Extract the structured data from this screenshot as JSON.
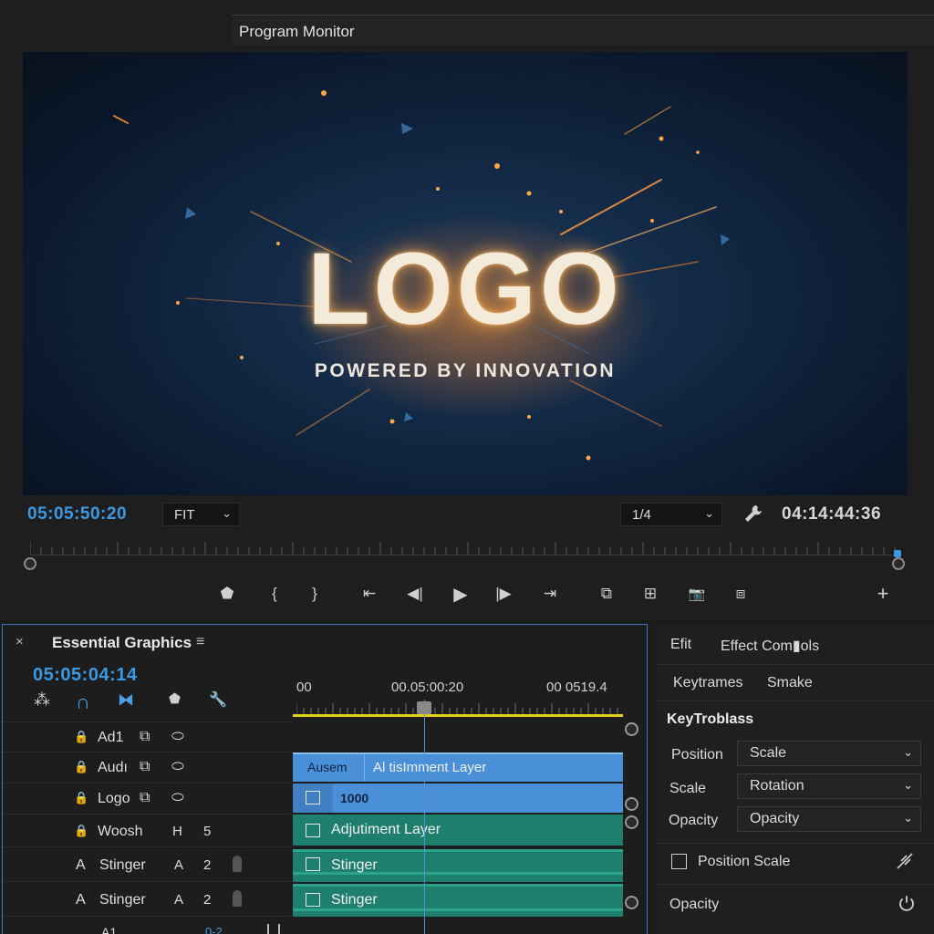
{
  "colors": {
    "accent_blue": "#3c9ae4",
    "clip_blue": "#4a90d9",
    "clip_teal": "#1f7f6e",
    "work_area_yellow": "#e6d21a",
    "panel_border": "#3a78c4"
  },
  "monitor": {
    "tab_title": "Program Monitor",
    "preview": {
      "logo": "LOGO",
      "tagline": "POWERED BY INNOVATION"
    },
    "current_timecode": "05:05:50:20",
    "zoom_value": "FIT",
    "resolution_value": "1/4",
    "duration_timecode": "04:14:44:36",
    "settings_icon": "wrench-icon",
    "transport": [
      {
        "name": "add-marker-button",
        "icon": "marker-icon",
        "glyph": "⬟"
      },
      {
        "name": "mark-in-button",
        "icon": "mark-in-icon",
        "glyph": "{"
      },
      {
        "name": "mark-out-button",
        "icon": "mark-out-icon",
        "glyph": "}"
      },
      {
        "name": "go-to-in-button",
        "icon": "go-to-in-icon",
        "glyph": "⇤"
      },
      {
        "name": "step-back-button",
        "icon": "step-back-icon",
        "glyph": "◀|"
      },
      {
        "name": "play-button",
        "icon": "play-icon",
        "glyph": "▶"
      },
      {
        "name": "step-forward-button",
        "icon": "step-forward-icon",
        "glyph": "|▶"
      },
      {
        "name": "go-to-out-button",
        "icon": "go-to-out-icon",
        "glyph": "⇥"
      },
      {
        "name": "lift-button",
        "icon": "lift-icon",
        "glyph": "⧉"
      },
      {
        "name": "extract-button",
        "icon": "extract-icon",
        "glyph": "⊞"
      },
      {
        "name": "export-frame-button",
        "icon": "camera-icon",
        "glyph": "📷"
      },
      {
        "name": "comparison-view-button",
        "icon": "comparison-icon",
        "glyph": "⧈"
      },
      {
        "name": "button-editor-button",
        "icon": "plus-icon",
        "glyph": "+"
      }
    ]
  },
  "essential_graphics": {
    "close_glyph": "×",
    "title": "Essential Graphics",
    "menu_glyph": "≡",
    "timecode": "05:05:04:14",
    "tools": [
      {
        "name": "nest-toggle",
        "icon": "nest-icon",
        "glyph": "⁂"
      },
      {
        "name": "snap-toggle",
        "icon": "magnet-icon",
        "glyph": "∩"
      },
      {
        "name": "linked-selection-toggle",
        "icon": "link-icon",
        "glyph": "⧓"
      },
      {
        "name": "add-marker-tool",
        "icon": "marker-icon",
        "glyph": "⬟"
      },
      {
        "name": "timeline-settings",
        "icon": "wrench-icon",
        "glyph": "🔧"
      }
    ],
    "tracks": [
      {
        "lock": "🔒",
        "label": "Ad1",
        "c1": "⧉",
        "c2": "⬭"
      },
      {
        "lock": "🔒",
        "label": "Audı",
        "c1": "⧉",
        "c2": "⬭"
      },
      {
        "lock": "🔒",
        "label": "Logo",
        "c1": "⧉",
        "c2": "⬭"
      },
      {
        "lock": "🔒",
        "label": "Woosh",
        "c1": "H",
        "c2": "5"
      },
      {
        "lock": "A",
        "label": "Stinger",
        "c1": "A",
        "c2": "2"
      },
      {
        "lock": "A",
        "label": "Stinger",
        "c1": "A",
        "c2": "2"
      },
      {
        "lock": "",
        "label": "A1",
        "c1": "",
        "c2": "0-2"
      }
    ],
    "ruler": [
      "00",
      "00.05:00:20",
      "00 0519.4"
    ],
    "clips": {
      "c1_short": "Ausem",
      "c1_long": "Al tisImment Layer",
      "c2": "1000",
      "c3": "Adjutiment Layer",
      "c4": "Stinger",
      "c5": "Stinger"
    }
  },
  "effect_controls": {
    "tab_edit": "Efit",
    "tab_effect_controls": "Effect Com▮ols",
    "tab_keyframes": "Keytrames",
    "tab_smake": "Smake",
    "section_title": "KeyTroblass",
    "rows": [
      {
        "label": "Position",
        "value": "Scale"
      },
      {
        "label": "Scale",
        "value": "Rotation"
      },
      {
        "label": "Opacity",
        "value": "Opacity"
      }
    ],
    "toggle_label": "Position  Scale",
    "opacity_label": "Opacity"
  }
}
